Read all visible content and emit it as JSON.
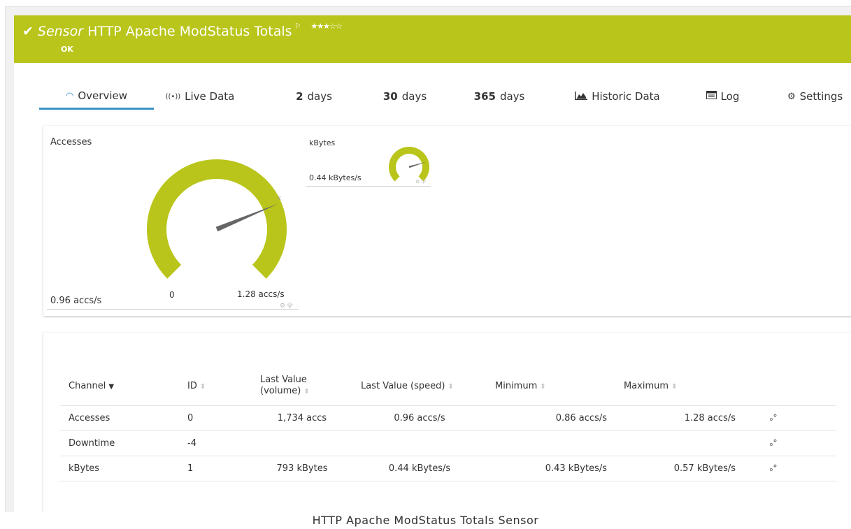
{
  "header": {
    "sensor_word": "Sensor",
    "sensor_name": "HTTP Apache ModStatus Totals",
    "flag_icon": "⚐",
    "stars": "★★★☆☆",
    "status": "OK",
    "color": "#b9c51a"
  },
  "tabs": [
    {
      "icon": "overview-icon",
      "num": "",
      "label": "Overview",
      "active": true
    },
    {
      "icon": "live-data-icon",
      "num": "",
      "label": "Live Data"
    },
    {
      "icon": "",
      "num": "2",
      "label": "days"
    },
    {
      "icon": "",
      "num": "30",
      "label": "days"
    },
    {
      "icon": "",
      "num": "365",
      "label": "days"
    },
    {
      "icon": "historic-data-icon",
      "num": "",
      "label": "Historic Data"
    },
    {
      "icon": "log-icon",
      "num": "",
      "label": "Log"
    },
    {
      "icon": "settings-icon",
      "num": "",
      "label": "Settings"
    }
  ],
  "gauges": {
    "accesses": {
      "title": "Accesses",
      "value_text": "0.96 accs/s",
      "min_text": "0",
      "max_text": "1.28 accs/s",
      "value": 0.96,
      "max": 1.28
    },
    "kbytes": {
      "title": "kBytes",
      "value_text": "0.44 kBytes/s",
      "value": 0.44,
      "max": 0.57
    }
  },
  "table": {
    "headers": {
      "channel": "Channel",
      "id": "ID",
      "last_value_volume_1": "Last Value",
      "last_value_volume_2": "(volume)",
      "last_value_speed": "Last Value (speed)",
      "minimum": "Minimum",
      "maximum": "Maximum"
    },
    "rows": [
      {
        "channel": "Accesses",
        "id": "0",
        "volume": "1,734 accs",
        "speed": "0.96 accs/s",
        "min": "0.86 accs/s",
        "max": "1.28 accs/s"
      },
      {
        "channel": "Downtime",
        "id": "-4",
        "volume": "",
        "speed": "",
        "min": "",
        "max": ""
      },
      {
        "channel": "kBytes",
        "id": "1",
        "volume": "793 kBytes",
        "speed": "0.44 kBytes/s",
        "min": "0.43 kBytes/s",
        "max": "0.57 kBytes/s"
      }
    ]
  },
  "caption": "HTTP Apache ModStatus Totals Sensor"
}
